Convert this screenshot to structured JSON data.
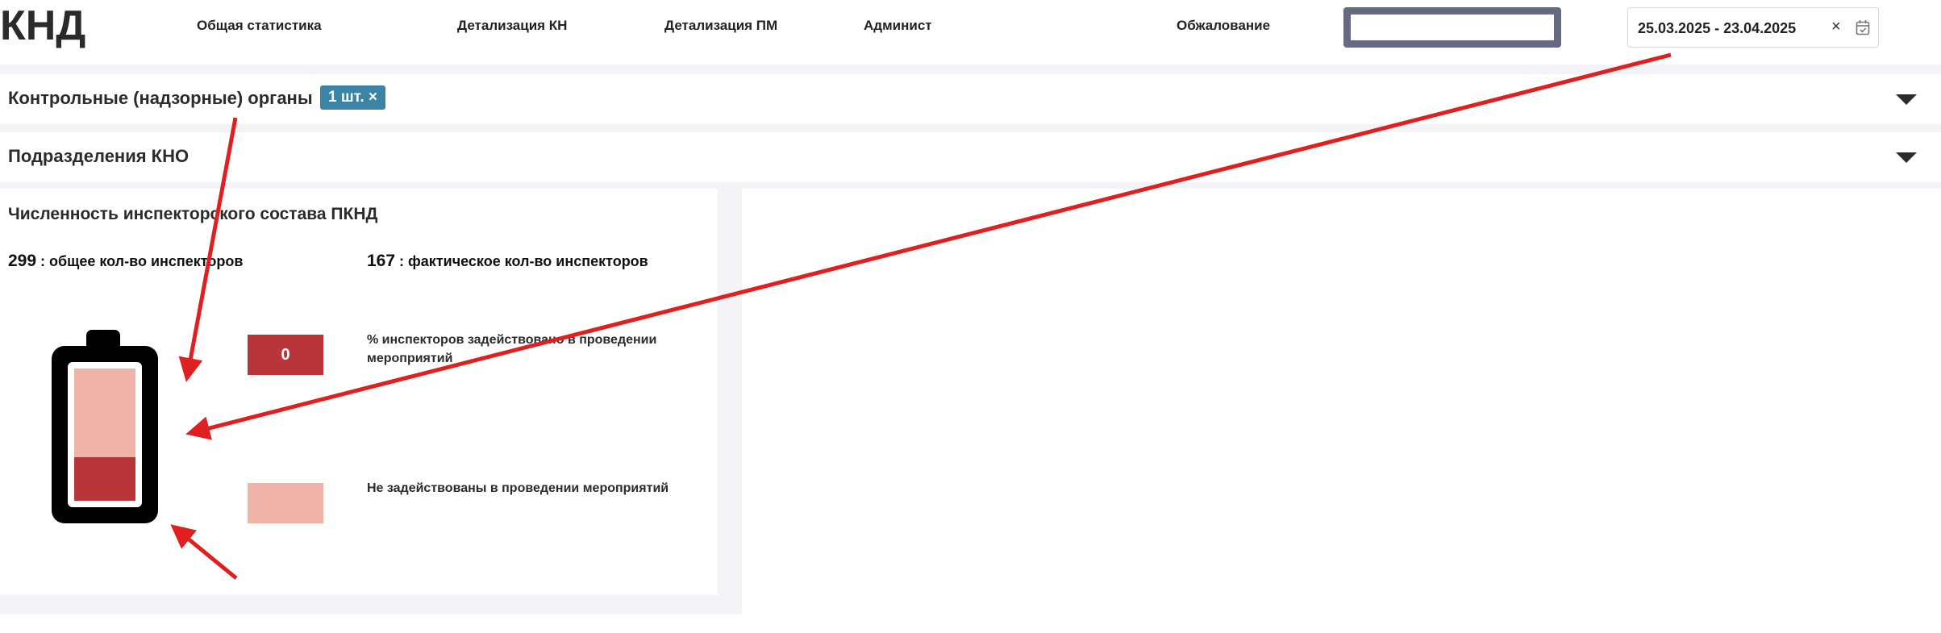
{
  "header": {
    "logo": "КНД",
    "nav": [
      {
        "label": "Общая статистика"
      },
      {
        "label": "Детализация КН"
      },
      {
        "label": "Детализация ПМ"
      },
      {
        "label": "Админист"
      },
      {
        "label": "Обжалование"
      }
    ],
    "search": {
      "value": "",
      "placeholder": ""
    },
    "date_range": {
      "value": "25.03.2025 - 23.04.2025",
      "clear_icon": "×",
      "calendar_icon": "calendar-icon"
    }
  },
  "filters": {
    "control_bodies": {
      "title": "Контрольные (надзорные) органы",
      "chip": "1 шт. ×"
    },
    "kno_units": {
      "title": "Подразделения КНО"
    }
  },
  "card": {
    "title": "Численность инспекторского состава ПКНД",
    "total": {
      "value": "299",
      "label": " : общее кол-во инспекторов"
    },
    "actual": {
      "value": "167",
      "label": " : фактическое кол-во инспекторов"
    },
    "legend": [
      {
        "value": "0",
        "label": "% инспекторов задействовано в проведении мероприятий",
        "color": "#b8353a"
      },
      {
        "value": "",
        "label": "Не задействованы в проведении мероприятий",
        "color": "#f0b3a8"
      }
    ],
    "battery": {
      "engaged_fraction": 0.33,
      "color_engaged": "#b8353a",
      "color_free": "#f0b3a8"
    }
  },
  "colors": {
    "accent": "#3a85a5",
    "annotation": "#e02020"
  }
}
